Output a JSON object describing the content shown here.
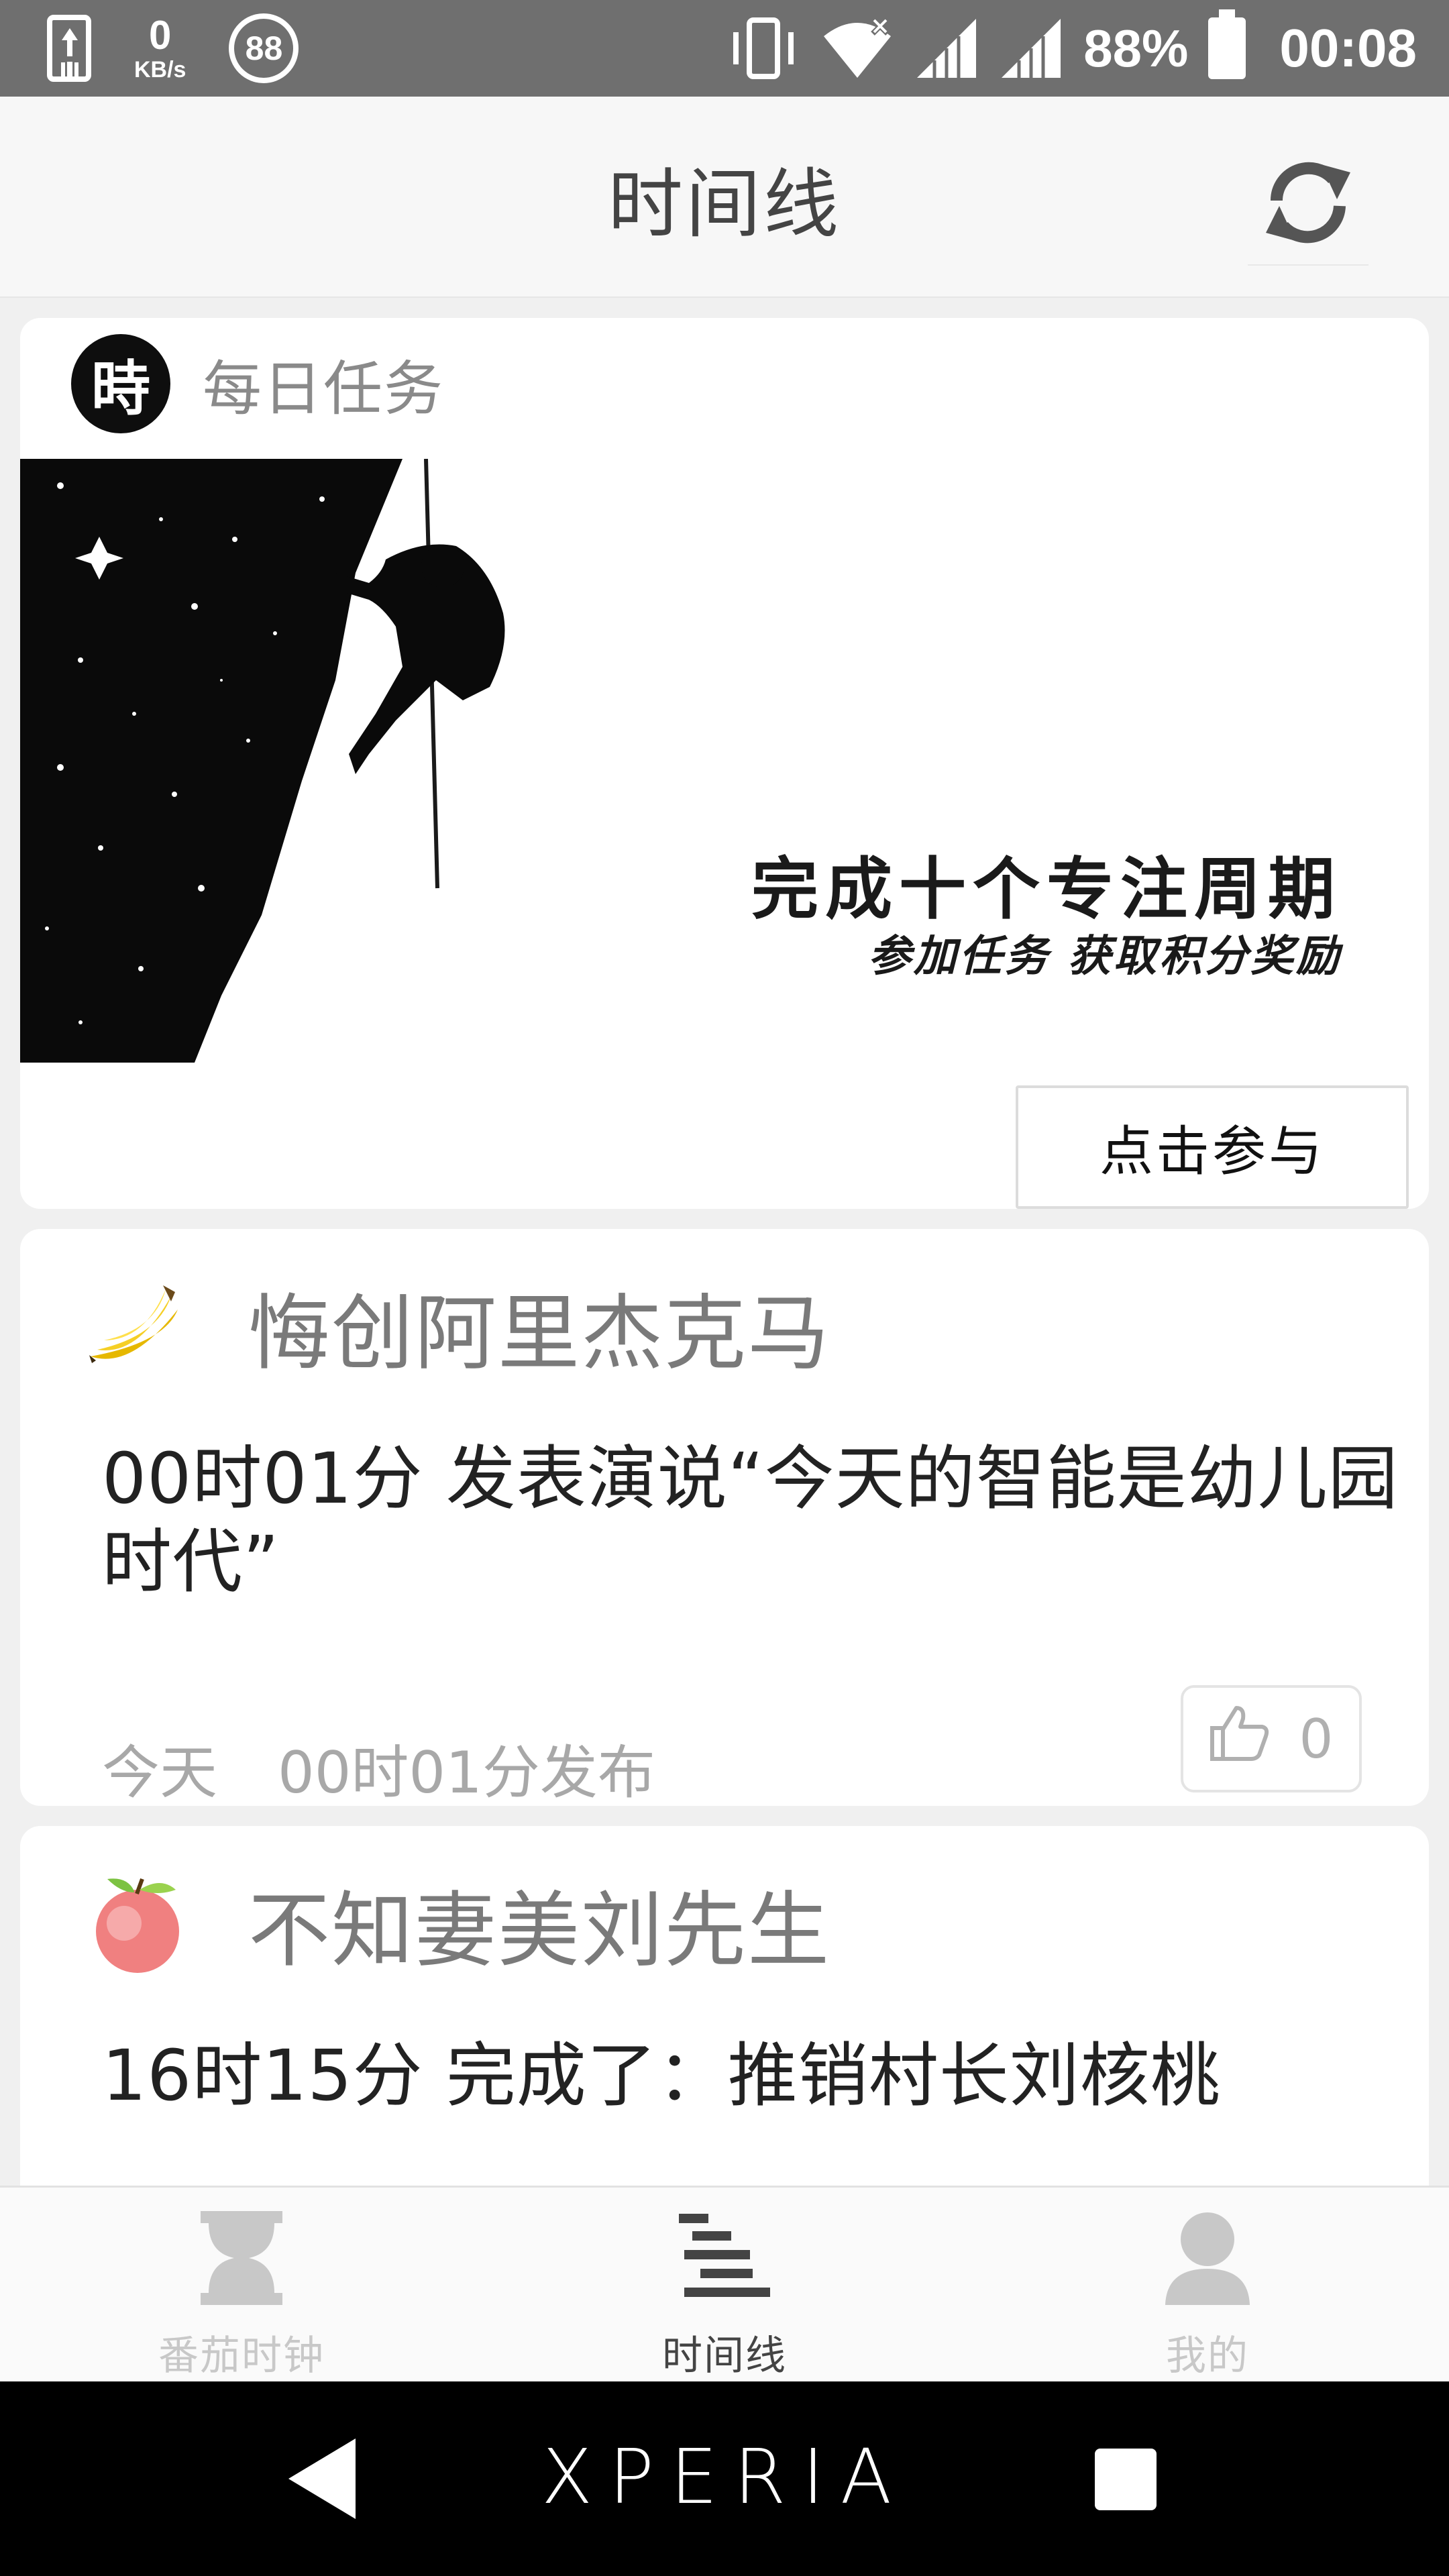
{
  "status_bar": {
    "net_speed_value": "0",
    "net_speed_unit": "KB/s",
    "badge": "88",
    "battery": "88%",
    "time": "00:08"
  },
  "header": {
    "title": "时间线",
    "refresh_icon": "refresh-icon"
  },
  "task_card": {
    "logo_char": "時",
    "title": "每日任务",
    "banner_headline": "完成十个专注周期",
    "banner_sub": "参加任务  获取积分奖励",
    "join_label": "点击参与"
  },
  "posts": [
    {
      "avatar": "banana",
      "user": "悔创阿里杰克马",
      "body": "00时01分   发表演说“今天的智能是幼儿园时代”",
      "date": "今天",
      "published": "00时01分发布",
      "likes": "0"
    },
    {
      "avatar": "apple",
      "user": "不知妻美刘先生",
      "body": "16时15分   完成了：推销村长刘核桃"
    }
  ],
  "bottom_nav": {
    "items": [
      {
        "label": "番茄时钟",
        "icon": "hourglass-icon",
        "active": false
      },
      {
        "label": "时间线",
        "icon": "timeline-icon",
        "active": true
      },
      {
        "label": "我的",
        "icon": "person-icon",
        "active": false
      }
    ]
  },
  "system_nav": {
    "brand": "XPERIA"
  },
  "colors": {
    "status_bar_bg": "#6f6f6f",
    "page_bg": "#f0f0f0",
    "active_nav": "#444444",
    "inactive_nav": "#c8c8c8"
  }
}
